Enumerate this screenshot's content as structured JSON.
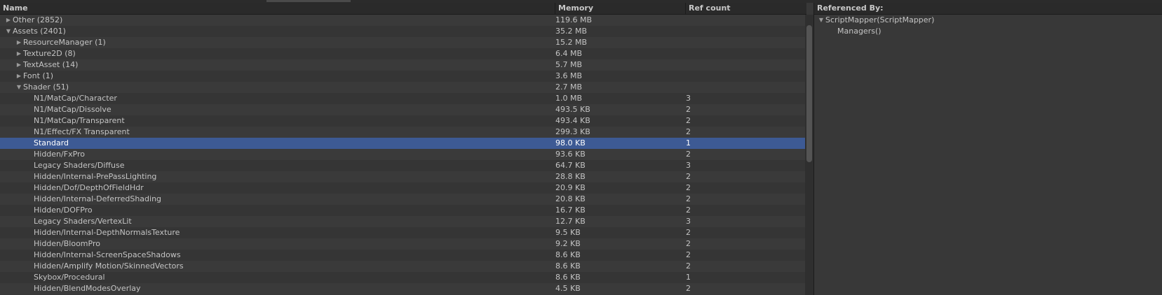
{
  "columns": {
    "name": "Name",
    "memory": "Memory",
    "ref_count": "Ref count"
  },
  "rows": [
    {
      "name": "Other (2852)",
      "memory": "119.6 MB",
      "ref": "",
      "depth": 0,
      "arrow": "collapsed"
    },
    {
      "name": "Assets (2401)",
      "memory": "35.2 MB",
      "ref": "",
      "depth": 0,
      "arrow": "expanded"
    },
    {
      "name": "ResourceManager (1)",
      "memory": "15.2 MB",
      "ref": "",
      "depth": 1,
      "arrow": "collapsed"
    },
    {
      "name": "Texture2D (8)",
      "memory": "6.4 MB",
      "ref": "",
      "depth": 1,
      "arrow": "collapsed"
    },
    {
      "name": "TextAsset (14)",
      "memory": "5.7 MB",
      "ref": "",
      "depth": 1,
      "arrow": "collapsed"
    },
    {
      "name": "Font (1)",
      "memory": "3.6 MB",
      "ref": "",
      "depth": 1,
      "arrow": "collapsed"
    },
    {
      "name": "Shader (51)",
      "memory": "2.7 MB",
      "ref": "",
      "depth": 1,
      "arrow": "expanded"
    },
    {
      "name": "N1/MatCap/Character",
      "memory": "1.0 MB",
      "ref": "3",
      "depth": 2,
      "arrow": "none"
    },
    {
      "name": "N1/MatCap/Dissolve",
      "memory": "493.5 KB",
      "ref": "2",
      "depth": 2,
      "arrow": "none"
    },
    {
      "name": "N1/MatCap/Transparent",
      "memory": "493.4 KB",
      "ref": "2",
      "depth": 2,
      "arrow": "none"
    },
    {
      "name": "N1/Effect/FX Transparent",
      "memory": "299.3 KB",
      "ref": "2",
      "depth": 2,
      "arrow": "none"
    },
    {
      "name": "Standard",
      "memory": "98.0 KB",
      "ref": "1",
      "depth": 2,
      "arrow": "none",
      "selected": true
    },
    {
      "name": "Hidden/FxPro",
      "memory": "93.6 KB",
      "ref": "2",
      "depth": 2,
      "arrow": "none"
    },
    {
      "name": "Legacy Shaders/Diffuse",
      "memory": "64.7 KB",
      "ref": "3",
      "depth": 2,
      "arrow": "none"
    },
    {
      "name": "Hidden/Internal-PrePassLighting",
      "memory": "28.8 KB",
      "ref": "2",
      "depth": 2,
      "arrow": "none"
    },
    {
      "name": "Hidden/Dof/DepthOfFieldHdr",
      "memory": "20.9 KB",
      "ref": "2",
      "depth": 2,
      "arrow": "none"
    },
    {
      "name": "Hidden/Internal-DeferredShading",
      "memory": "20.8 KB",
      "ref": "2",
      "depth": 2,
      "arrow": "none"
    },
    {
      "name": "Hidden/DOFPro",
      "memory": "16.7 KB",
      "ref": "2",
      "depth": 2,
      "arrow": "none"
    },
    {
      "name": "Legacy Shaders/VertexLit",
      "memory": "12.7 KB",
      "ref": "3",
      "depth": 2,
      "arrow": "none"
    },
    {
      "name": "Hidden/Internal-DepthNormalsTexture",
      "memory": "9.5 KB",
      "ref": "2",
      "depth": 2,
      "arrow": "none"
    },
    {
      "name": "Hidden/BloomPro",
      "memory": "9.2 KB",
      "ref": "2",
      "depth": 2,
      "arrow": "none"
    },
    {
      "name": "Hidden/Internal-ScreenSpaceShadows",
      "memory": "8.6 KB",
      "ref": "2",
      "depth": 2,
      "arrow": "none"
    },
    {
      "name": "Hidden/Amplify Motion/SkinnedVectors",
      "memory": "8.6 KB",
      "ref": "2",
      "depth": 2,
      "arrow": "none"
    },
    {
      "name": "Skybox/Procedural",
      "memory": "8.6 KB",
      "ref": "1",
      "depth": 2,
      "arrow": "none"
    },
    {
      "name": "Hidden/BlendModesOverlay",
      "memory": "4.5 KB",
      "ref": "2",
      "depth": 2,
      "arrow": "none"
    }
  ],
  "referenced_by": {
    "title": "Referenced By:",
    "items": [
      {
        "label": "ScriptMapper(ScriptMapper)",
        "depth": 0,
        "arrow": "expanded"
      },
      {
        "label": "Managers()",
        "depth": 1,
        "arrow": "none"
      }
    ]
  },
  "colors": {
    "selected_row": "#3d5a94",
    "background": "#383838",
    "header": "#2a2a2a"
  }
}
